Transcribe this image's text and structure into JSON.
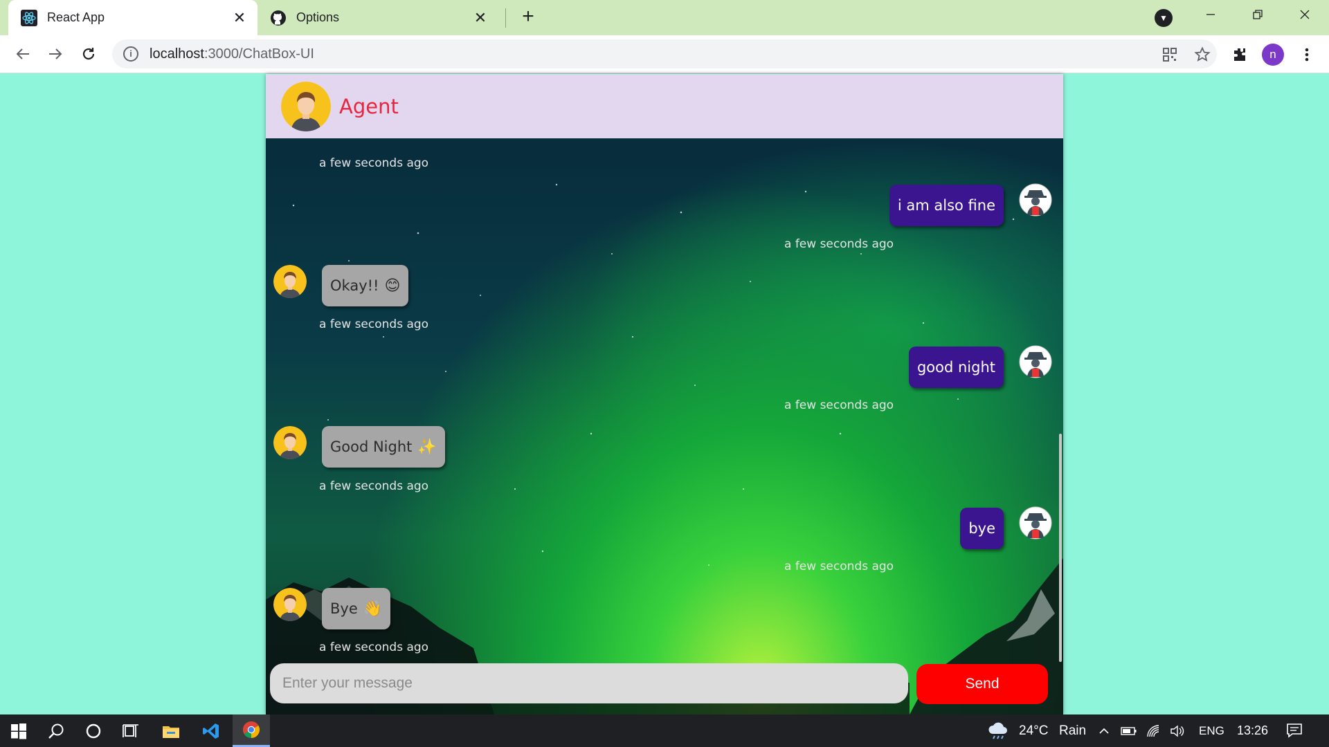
{
  "browser": {
    "tabs": [
      {
        "title": "React App",
        "icon": "react-icon",
        "active": true
      },
      {
        "title": "Options",
        "icon": "github-icon",
        "active": false
      }
    ],
    "url_host": "localhost",
    "url_rest": ":3000/ChatBox-UI",
    "profile_initial": "n"
  },
  "chat": {
    "header": {
      "name": "Agent"
    },
    "messages": [
      {
        "sender": "agent",
        "text": "",
        "time": "a few seconds ago",
        "partial": true
      },
      {
        "sender": "user",
        "text": "i am also fine",
        "time": "a few seconds ago"
      },
      {
        "sender": "agent",
        "text": "Okay!!",
        "emoji": "😊",
        "time": "a few seconds ago"
      },
      {
        "sender": "user",
        "text": "good night",
        "time": "a few seconds ago"
      },
      {
        "sender": "agent",
        "text": "Good Night",
        "emoji": "✨",
        "time": "a few seconds ago"
      },
      {
        "sender": "user",
        "text": "bye",
        "time": "a few seconds ago"
      },
      {
        "sender": "agent",
        "text": "Bye",
        "emoji": "👋",
        "time": "a few seconds ago"
      }
    ],
    "input": {
      "placeholder": "Enter your message",
      "value": ""
    },
    "send_label": "Send"
  },
  "taskbar": {
    "weather": {
      "temp": "24°C",
      "condition": "Rain"
    },
    "language": "ENG",
    "time": "13:26"
  },
  "colors": {
    "page_background": "#8ff5da",
    "header_background": "#e3d6ef",
    "agent_name": "#e8243e",
    "agent_bubble": "#a6a6a6",
    "user_bubble": "#3b148f",
    "send_button": "#ff0000"
  }
}
